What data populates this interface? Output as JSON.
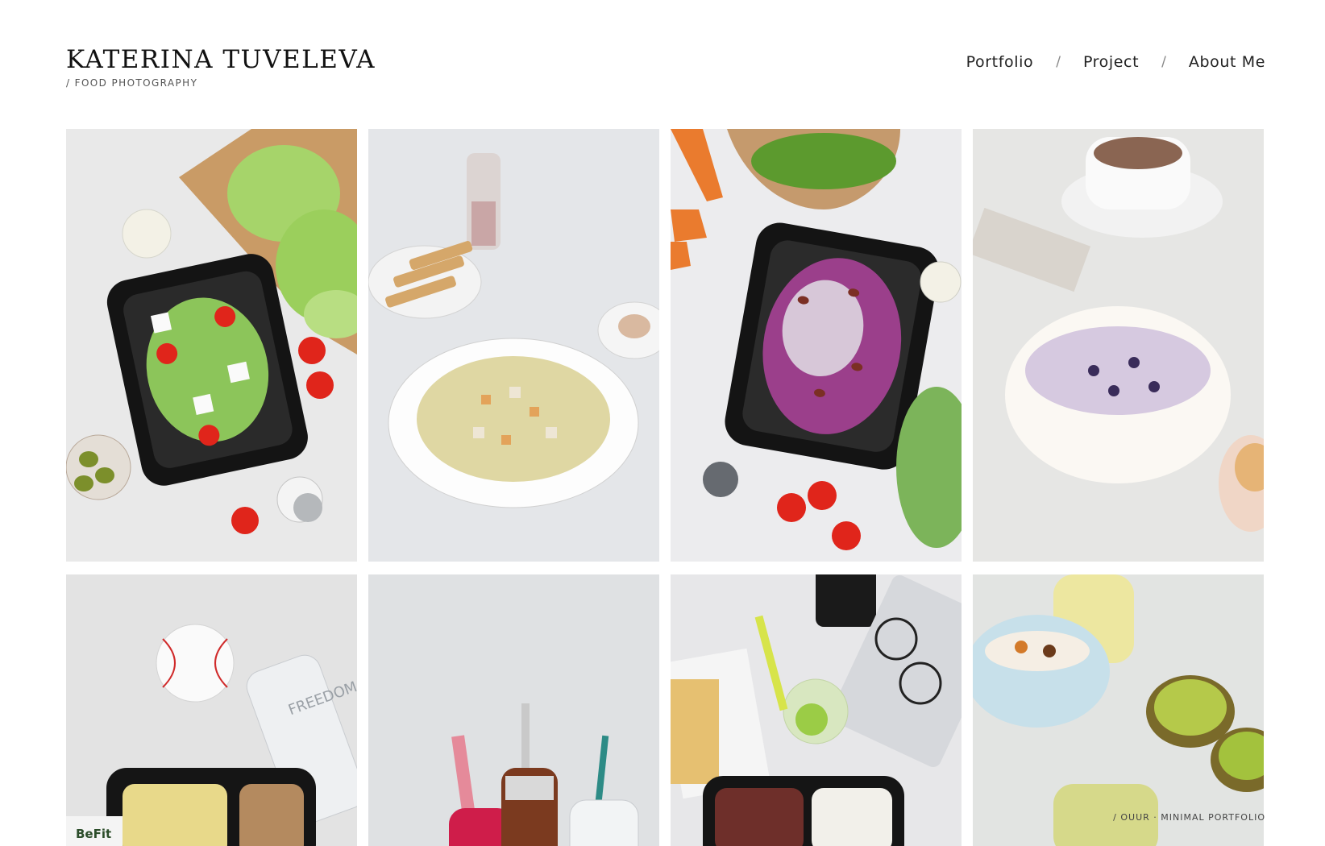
{
  "brand": {
    "title": "KATERINA TUVELEVA",
    "subtitle": "/ FOOD PHOTOGRAPHY"
  },
  "nav": {
    "items": [
      {
        "label": "Portfolio"
      },
      {
        "label": "Project"
      },
      {
        "label": "About Me"
      }
    ],
    "separator": "/"
  },
  "gallery": {
    "photos": [
      {
        "name": "greek-salad-container-photo",
        "bg": "#e9e9e9"
      },
      {
        "name": "vegetable-soup-bowl-photo",
        "bg": "#e4e6e9"
      },
      {
        "name": "cabbage-bean-salad-photo",
        "bg": "#ececee"
      },
      {
        "name": "oatmeal-blueberry-bowl-photo",
        "bg": "#e6e6e4"
      },
      {
        "name": "baseball-meal-box-photo",
        "bg": "#e3e3e3"
      },
      {
        "name": "juice-bottles-photo",
        "bg": "#dfe1e3"
      },
      {
        "name": "meal-box-glasses-photo",
        "bg": "#e7e7e9"
      },
      {
        "name": "yogurt-kiwi-photo",
        "bg": "#e2e4e2"
      }
    ],
    "labels": {
      "bottle_text": "FREEDOM",
      "box_brand": "BeFit"
    }
  },
  "footer": {
    "credit": "/ OUUR · MINIMAL PORTFOLIO"
  }
}
